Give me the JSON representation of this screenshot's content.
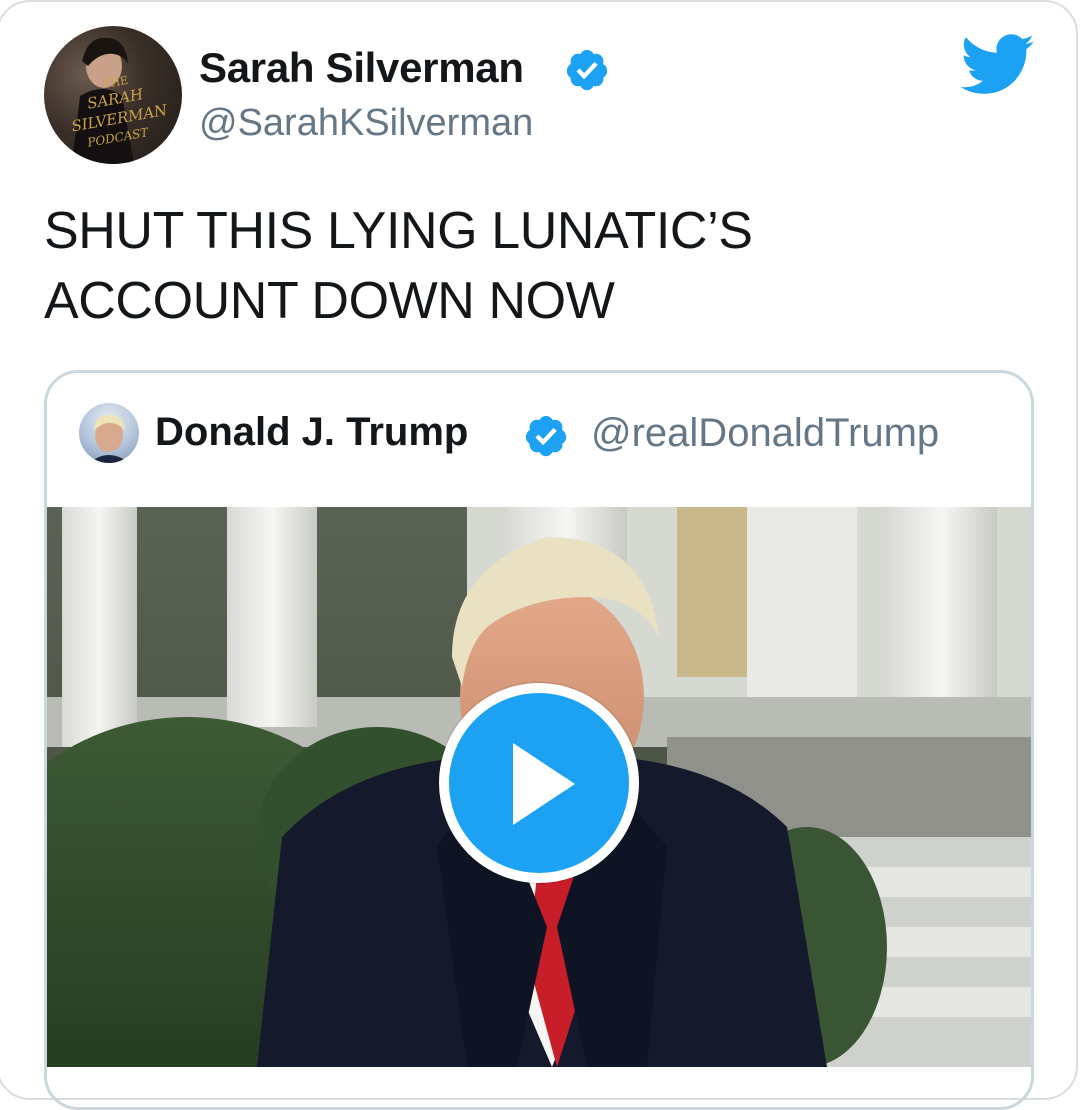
{
  "tweet": {
    "author_name": "Sarah Silverman",
    "author_handle": "@SarahKSilverman",
    "avatar_logo_text": "THE SARAH SILVERMAN PODCAST",
    "text_lines": [
      "SHUT THIS LYING LUNATIC’S",
      "ACCOUNT DOWN NOW"
    ],
    "verified": true
  },
  "quoted_tweet": {
    "author_name": "Donald J. Trump",
    "author_handle": "@realDonaldTrump",
    "verified": true,
    "media": {
      "type": "video",
      "play_icon": "play-icon"
    }
  },
  "icons": {
    "brand": "twitter-bird-icon",
    "verified": "verified-badge-icon"
  },
  "colors": {
    "twitter_blue": "#1da1f2",
    "text": "#14171a",
    "secondary_text": "#657786",
    "border": "#ccd6dd"
  }
}
